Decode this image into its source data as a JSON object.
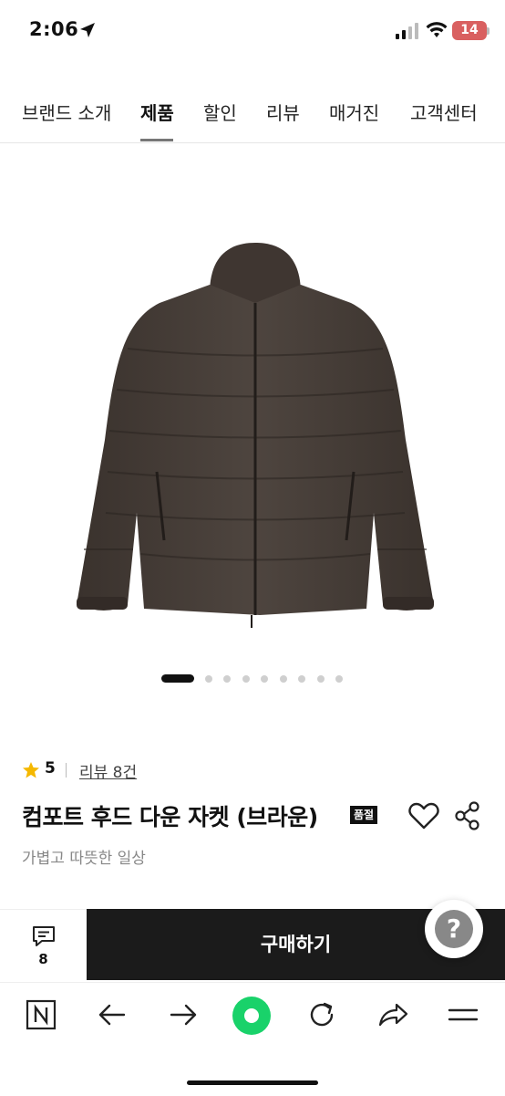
{
  "status_bar": {
    "time": "2:06",
    "battery": "14",
    "icons": [
      "location-arrow-icon",
      "signal-icon",
      "wifi-icon",
      "battery-icon"
    ]
  },
  "nav": {
    "items": [
      "브랜드 소개",
      "제품",
      "할인",
      "리뷰",
      "매거진",
      "고객센터"
    ],
    "active": "제품"
  },
  "gallery": {
    "image": "brown-hooded-down-jacket",
    "page_count": 9,
    "current_page": 1
  },
  "product": {
    "rating": "5",
    "review_link": "리뷰 8건",
    "title": "컴포트 후드 다운 자켓 (브라운)",
    "badge": "품절",
    "subtitle": "가볍고 따뜻한 일상"
  },
  "actions": {
    "comment_count": "8",
    "buy_label": "구매하기",
    "help_label": "?"
  },
  "toolbar": {
    "icons": [
      "naver-n-icon",
      "back-arrow-icon",
      "forward-arrow-icon",
      "green-home-icon",
      "refresh-icon",
      "share-arrow-icon",
      "menu-icon"
    ]
  },
  "colors": {
    "accent_star": "#f5b800",
    "buy_bg": "#1b1b1b",
    "toolbar_green": "#19d26a",
    "battery": "#d96060"
  }
}
